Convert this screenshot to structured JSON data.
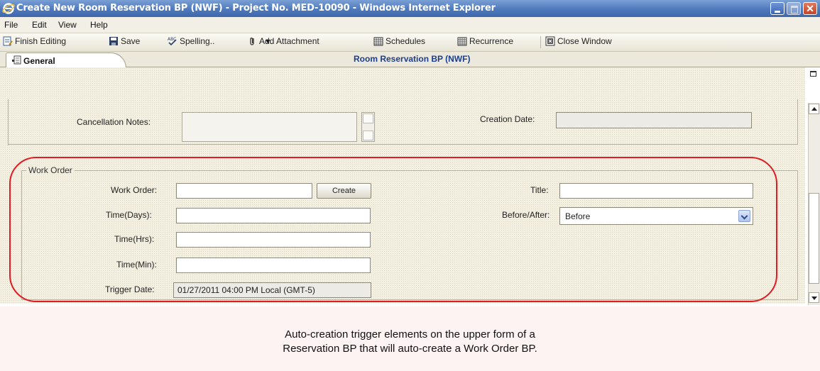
{
  "window": {
    "title": "Create New Room Reservation BP (NWF) - Project No. MED-10090 - Windows Internet Explorer",
    "close_glyph": "✕"
  },
  "menu": [
    "File",
    "Edit",
    "View",
    "Help"
  ],
  "toolbar": {
    "finish_editing": "Finish Editing",
    "save": "Save",
    "spelling": "Spelling..",
    "add_attachment": "Add Attachment",
    "add_attachment_arrow": "▾",
    "schedules": "Schedules",
    "recurrence": "Recurrence",
    "close_window": "Close Window"
  },
  "tabs": {
    "general": "General"
  },
  "form_title": "Room Reservation BP (NWF)",
  "upper_section": {
    "cancellation_notes_label": "Cancellation Notes:",
    "cancellation_notes_value": "",
    "creation_date_label": "Creation Date:",
    "creation_date_value": ""
  },
  "work_order": {
    "legend": "Work Order",
    "work_order_label": "Work Order:",
    "work_order_value": "",
    "create_button": "Create",
    "title_label": "Title:",
    "title_value": "",
    "time_days_label": "Time(Days):",
    "time_days_value": "",
    "before_after_label": "Before/After:",
    "before_after_value": "Before",
    "time_hrs_label": "Time(Hrs):",
    "time_hrs_value": "",
    "time_min_label": "Time(Min):",
    "time_min_value": "",
    "trigger_date_label": "Trigger Date:",
    "trigger_date_value": "01/27/2011 04:00 PM  Local (GMT-5)"
  },
  "caption": {
    "line1": "Auto-creation trigger elements on the upper form of a",
    "line2": "Reservation BP that will auto-create a Work Order BP."
  },
  "colors": {
    "titlebar": "#4f79bd",
    "highlight": "#e11b22",
    "form_title": "#1b3f8f"
  }
}
